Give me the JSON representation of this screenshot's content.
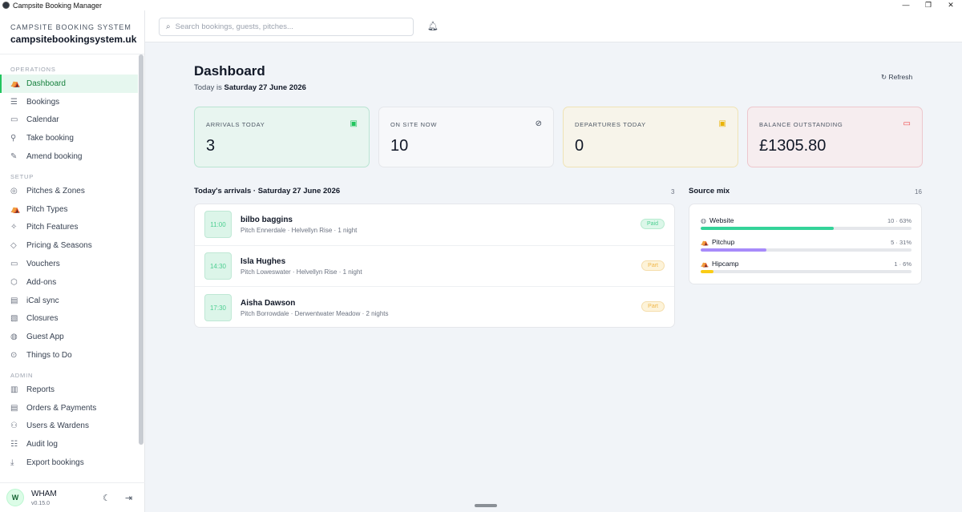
{
  "window": {
    "title": "Campsite Booking Manager",
    "controls": [
      "—",
      "❐",
      "✕"
    ]
  },
  "brand": {
    "kicker": "CAMPSITE BOOKING SYSTEM",
    "domain": "campsitebookingsystem.uk"
  },
  "nav": {
    "operations_label": "OPERATIONS",
    "operations": [
      {
        "label": "Dashboard",
        "icon": "tent-icon",
        "active": true
      },
      {
        "label": "Bookings",
        "icon": "list-icon"
      },
      {
        "label": "Calendar",
        "icon": "calendar-icon"
      },
      {
        "label": "Take booking",
        "icon": "user-plus-icon"
      },
      {
        "label": "Amend booking",
        "icon": "edit-icon"
      }
    ],
    "setup_label": "SETUP",
    "setup": [
      {
        "label": "Pitches & Zones",
        "icon": "map-pin-icon"
      },
      {
        "label": "Pitch Types",
        "icon": "tent-icon"
      },
      {
        "label": "Pitch Features",
        "icon": "sparkle-icon"
      },
      {
        "label": "Pricing & Seasons",
        "icon": "tag-icon"
      },
      {
        "label": "Vouchers",
        "icon": "ticket-icon"
      },
      {
        "label": "Add-ons",
        "icon": "box-icon"
      },
      {
        "label": "iCal sync",
        "icon": "calendar-sync-icon"
      },
      {
        "label": "Closures",
        "icon": "calendar-x-icon"
      },
      {
        "label": "Guest App",
        "icon": "globe-icon"
      },
      {
        "label": "Things to Do",
        "icon": "compass-icon"
      }
    ],
    "admin_label": "ADMIN",
    "admin": [
      {
        "label": "Reports",
        "icon": "bar-chart-icon"
      },
      {
        "label": "Orders & Payments",
        "icon": "receipt-icon"
      },
      {
        "label": "Users & Wardens",
        "icon": "users-icon"
      },
      {
        "label": "Audit log",
        "icon": "list-check-icon"
      },
      {
        "label": "Export bookings",
        "icon": "download-icon"
      }
    ]
  },
  "user": {
    "initial": "W",
    "name": "WHAM",
    "version": "v0.15.0"
  },
  "search": {
    "placeholder": "Search bookings, guests, pitches..."
  },
  "dashboard": {
    "title": "Dashboard",
    "today_prefix": "Today is",
    "today_date": "Saturday 27 June 2026",
    "refresh_label": "Refresh"
  },
  "stats": [
    {
      "label": "ARRIVALS TODAY",
      "value": "3",
      "icon": "calendar-check-icon",
      "color": "#22c55e"
    },
    {
      "label": "ON SITE NOW",
      "value": "10",
      "icon": "check-circle-icon",
      "color": "#374151"
    },
    {
      "label": "DEPARTURES TODAY",
      "value": "0",
      "icon": "calendar-out-icon",
      "color": "#eab308"
    },
    {
      "label": "BALANCE OUTSTANDING",
      "value": "£1305.80",
      "icon": "credit-card-icon",
      "color": "#ef4444"
    }
  ],
  "arrivals": {
    "heading": "Today's arrivals · Saturday 27 June 2026",
    "count": "3",
    "rows": [
      {
        "time": "11:00",
        "name": "bilbo baggins",
        "detail": "Pitch Ennerdale · Helvellyn Rise · 1 night",
        "status": "Paid"
      },
      {
        "time": "14:30",
        "name": "Isla Hughes",
        "detail": "Pitch Loweswater · Helvellyn Rise · 1 night",
        "status": "Part"
      },
      {
        "time": "17:30",
        "name": "Aisha Dawson",
        "detail": "Pitch Borrowdale · Derwentwater Meadow · 2 nights",
        "status": "Part"
      }
    ]
  },
  "source_mix": {
    "heading": "Source mix",
    "total": "16",
    "sources": [
      {
        "name": "Website",
        "icon": "globe-icon",
        "count_text": "10 · 63%",
        "share": 0.63,
        "color": "#34d399"
      },
      {
        "name": "Pitchup",
        "icon": "tent-icon",
        "count_text": "5 · 31%",
        "share": 0.31,
        "color": "#a78bfa"
      },
      {
        "name": "Hipcamp",
        "icon": "tent-icon",
        "count_text": "1 · 6%",
        "share": 0.06,
        "color": "#facc15"
      }
    ]
  }
}
